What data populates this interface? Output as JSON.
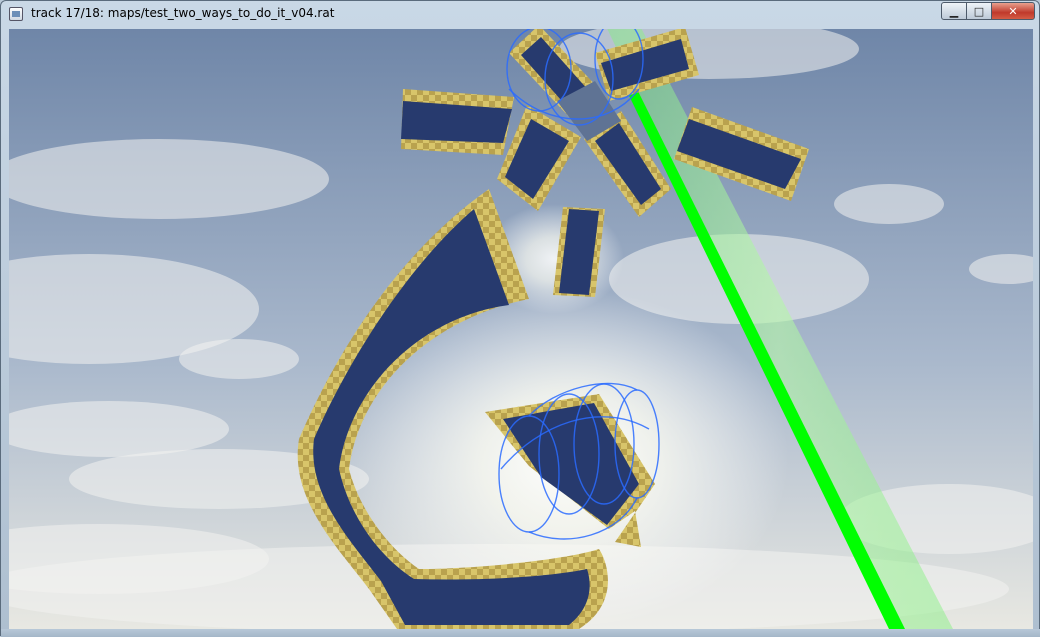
{
  "window": {
    "title": "track 17/18: maps/test_two_ways_to_do_it_v04.rat",
    "controls": {
      "minimize_glyph": "▁",
      "maximize_glyph": "□",
      "close_glyph": "✕"
    }
  },
  "scene": {
    "colors": {
      "sky_top": "#6f86a8",
      "sky_bottom": "#e8e8e2",
      "track_face": "#273a6e",
      "track_edge": "#d8c56a",
      "checkpoint_ring": "#2a6bff",
      "guide_beam": "#00ff00"
    },
    "icons": [
      "window-icon",
      "minimize-icon",
      "maximize-icon",
      "close-icon"
    ]
  }
}
